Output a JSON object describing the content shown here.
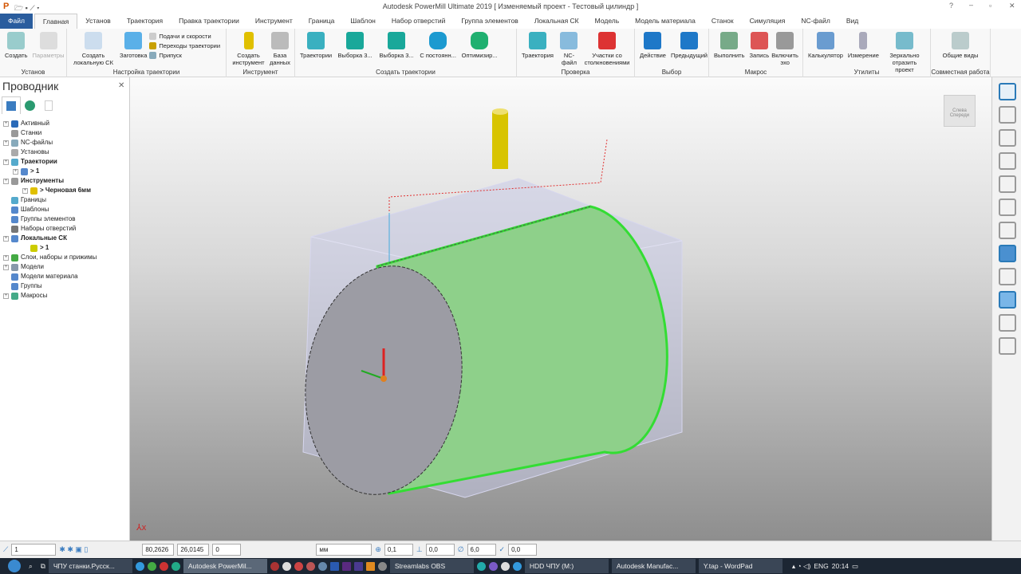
{
  "app": {
    "title": "Autodesk PowerMill Ultimate 2019   [ Изменяемый проект - Тестовый цилиндр ]"
  },
  "tabs": [
    "Файл",
    "Главная",
    "Установ",
    "Траектория",
    "Правка траектории",
    "Инструмент",
    "Граница",
    "Шаблон",
    "Набор отверстий",
    "Группа элементов",
    "Локальная СК",
    "Модель",
    "Модель материала",
    "Станок",
    "Симуляция",
    "NC-файл",
    "Вид"
  ],
  "ribbon": {
    "g1": {
      "label": "Установ",
      "b": [
        "Создать",
        "Параметры"
      ]
    },
    "g2": {
      "label": "Настройка траектории",
      "b": [
        "Создать локальную СК",
        "Заготовка"
      ],
      "small": [
        "Подачи и скорости",
        "Переходы траектории",
        "Припуск"
      ]
    },
    "g3": {
      "label": "Инструмент",
      "b": [
        "Создать инструмент",
        "База данных"
      ]
    },
    "g4": {
      "label": "Создать траектории",
      "b": [
        "Траектории",
        "Выборка 3...",
        "Выборка 3...",
        "С постоянн...",
        "Оптимизир..."
      ]
    },
    "g5": {
      "label": "Проверка",
      "b": [
        "Траектория",
        "NC-файл",
        "Участки со столкновениями"
      ]
    },
    "g6": {
      "label": "Выбор",
      "b": [
        "Действие",
        "Предыдущий"
      ]
    },
    "g7": {
      "label": "Макрос",
      "b": [
        "Выполнить",
        "Запись",
        "Включить эхо"
      ]
    },
    "g8": {
      "label": "Утилиты",
      "b": [
        "Калькулятор",
        "Измерение",
        "Зеркально отразить проект"
      ]
    },
    "g9": {
      "label": "Совместная работа",
      "b": [
        "Общие виды"
      ]
    }
  },
  "explorer": {
    "title": "Проводник",
    "items": [
      "Активный",
      "Станки",
      "NC-файлы",
      "Установы",
      "Траектории",
      "> 1",
      "Инструменты",
      "> Черновая 6мм",
      "Границы",
      "Шаблоны",
      "Группы элементов",
      "Наборы отверстий",
      "Локальные СК",
      "> 1",
      "Слои, наборы и прижимы",
      "Модели",
      "Модели материала",
      "Группы",
      "Макросы"
    ]
  },
  "viewcube": {
    "labels": [
      "Слева",
      "Спереди"
    ]
  },
  "status": {
    "wp": "1",
    "x": "80,2626",
    "y": "26,0145",
    "z": "0",
    "units": "мм",
    "tol": "0,1",
    "stock": "0,0",
    "dia": "6,0",
    "step": "0,0"
  },
  "taskbar": {
    "items": [
      "ЧПУ станки.Русск...",
      "Autodesk PowerMil...",
      "Streamlabs OBS",
      "HDD ЧПУ (M:)",
      "Autodesk Manufac...",
      "Y.tap - WordPad"
    ],
    "lang": "ENG",
    "time": "20:14"
  },
  "colors": {
    "accent": "#2a5d9e",
    "toolpath": "#66ee55",
    "tool": "#d8c400"
  }
}
